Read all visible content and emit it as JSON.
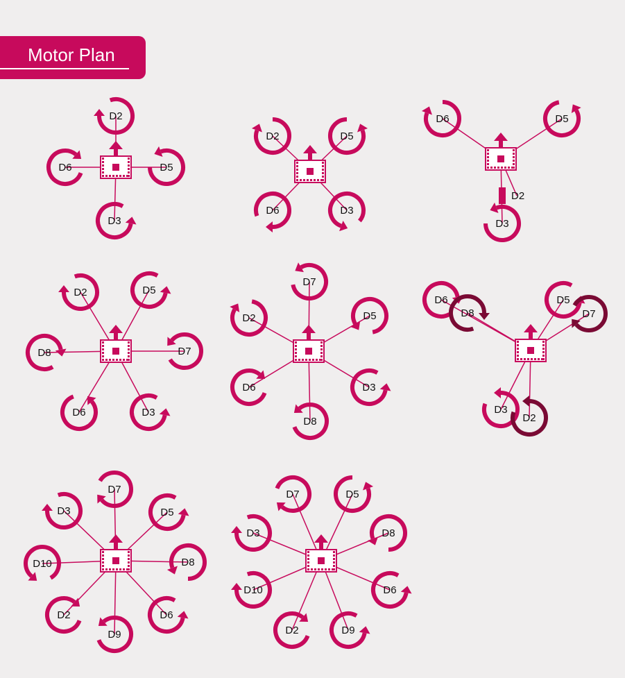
{
  "title": "Motor Plan",
  "colors": {
    "accent": "#c70a5c",
    "dark_accent": "#7a0a34",
    "background": "#f0eeee"
  },
  "configurations": [
    {
      "name": "quad-plus",
      "motors": [
        "D2",
        "D5",
        "D3",
        "D6"
      ]
    },
    {
      "name": "quad-x",
      "motors": [
        "D2",
        "D5",
        "D6",
        "D3"
      ]
    },
    {
      "name": "tri",
      "motors": [
        "D6",
        "D5",
        "D2",
        "D3"
      ]
    },
    {
      "name": "hex-x",
      "motors": [
        "D2",
        "D5",
        "D8",
        "D7",
        "D6",
        "D3"
      ]
    },
    {
      "name": "hex-plus",
      "motors": [
        "D7",
        "D2",
        "D5",
        "D6",
        "D3",
        "D8"
      ]
    },
    {
      "name": "y6",
      "motors": [
        "D6",
        "D8",
        "D5",
        "D7",
        "D3",
        "D2"
      ]
    },
    {
      "name": "octo-plus",
      "motors": [
        "D7",
        "D3",
        "D5",
        "D10",
        "D8",
        "D2",
        "D6",
        "D9"
      ]
    },
    {
      "name": "octo-x",
      "motors": [
        "D7",
        "D5",
        "D3",
        "D8",
        "D10",
        "D6",
        "D2",
        "D9"
      ]
    }
  ]
}
